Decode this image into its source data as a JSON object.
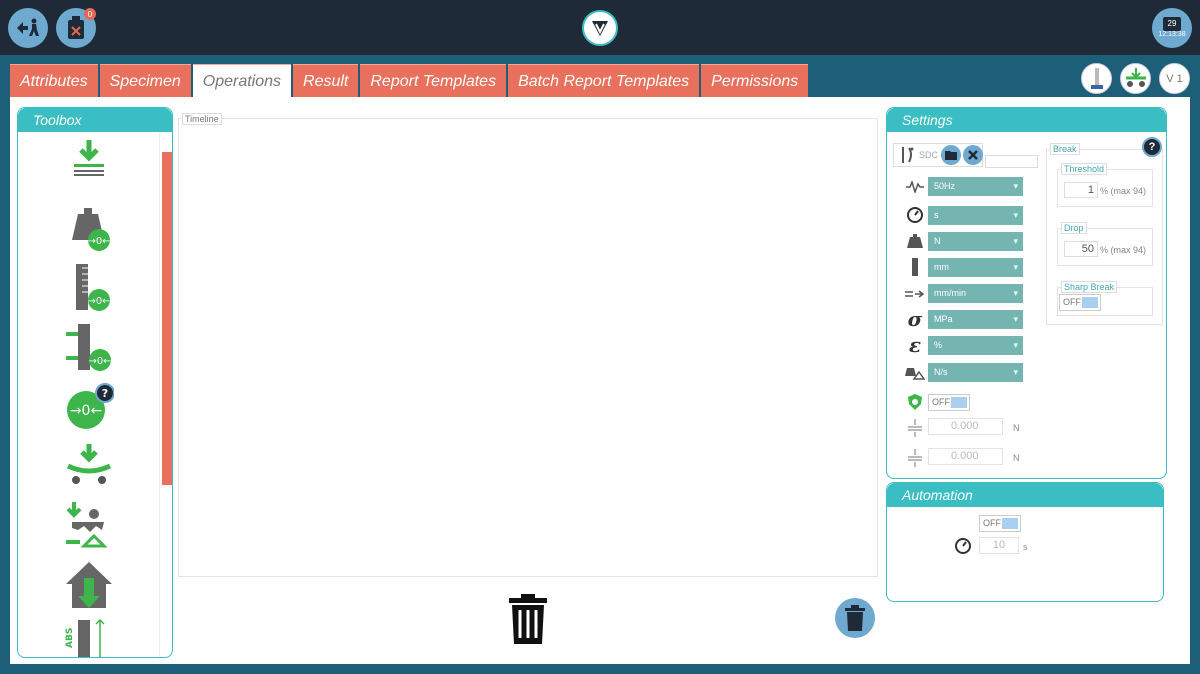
{
  "topbar": {
    "usb_badge": "0",
    "calendar_day": "29",
    "clock": "12:13:38"
  },
  "tabs": [
    {
      "label": "Attributes"
    },
    {
      "label": "Specimen"
    },
    {
      "label": "Operations"
    },
    {
      "label": "Result"
    },
    {
      "label": "Report Templates"
    },
    {
      "label": "Batch Report Templates"
    },
    {
      "label": "Permissions"
    }
  ],
  "right_icons": {
    "version": "V 1"
  },
  "toolbox": {
    "title": "Toolbox",
    "abs_label": "ABS"
  },
  "timeline": {
    "label": "Timeline"
  },
  "settings": {
    "title": "Settings",
    "sdc_label": "SDC",
    "selects": [
      "50Hz",
      "s",
      "N",
      "mm",
      "mm/min",
      "MPa",
      "%",
      "N/s"
    ],
    "toggle_off": "OFF",
    "field1": "0.000",
    "field1_unit": "N",
    "field2": "0.000",
    "field2_unit": "N",
    "break": {
      "label": "Break",
      "threshold_label": "Threshold",
      "threshold_value": "1",
      "threshold_hint": "% (max 94)",
      "drop_label": "Drop",
      "drop_value": "50",
      "drop_hint": "% (max 94)",
      "sharp_label": "Sharp Break",
      "sharp_toggle": "OFF"
    }
  },
  "automation": {
    "title": "Automation",
    "toggle": "OFF",
    "seconds": "10",
    "unit": "s"
  },
  "colors": {
    "accent": "#3bbec3",
    "tab": "#e8705d",
    "green": "#3db54a",
    "gray": "#666666"
  }
}
